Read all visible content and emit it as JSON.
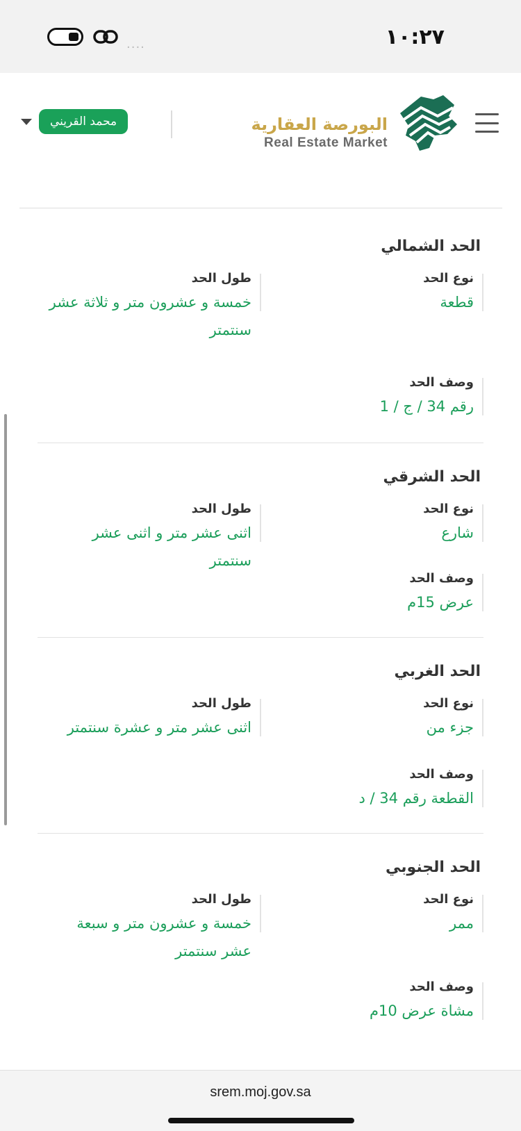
{
  "status_bar": {
    "time": "١٠:٢٧",
    "signal": "····"
  },
  "header": {
    "logo_ar": "البورصة العقارية",
    "logo_en": "Real Estate Market",
    "user_name": "محمد القريني"
  },
  "boundaries": [
    {
      "title": "الحد الشمالي",
      "type_label": "نوع الحد",
      "type_value": "قطعة",
      "length_label": "طول الحد",
      "length_value": "خمسة و عشرون متر و ثلاثة عشر سنتمتر",
      "desc_label": "وصف الحد",
      "desc_value": "رقم 34 / ج / 1"
    },
    {
      "title": "الحد الشرقي",
      "type_label": "نوع الحد",
      "type_value": "شارع",
      "length_label": "طول الحد",
      "length_value": "اثنى عشر متر و اثنى عشر سنتمتر",
      "desc_label": "وصف الحد",
      "desc_value": "عرض 15م"
    },
    {
      "title": "الحد الغربي",
      "type_label": "نوع الحد",
      "type_value": "جزء من",
      "length_label": "طول الحد",
      "length_value": "اثنى عشر متر و عشرة سنتمتر",
      "desc_label": "وصف الحد",
      "desc_value": "القطعة رقم 34 / د"
    },
    {
      "title": "الحد الجنوبي",
      "type_label": "نوع الحد",
      "type_value": "ممر",
      "length_label": "طول الحد",
      "length_value": "خمسة و عشرون متر و سبعة عشر سنتمتر",
      "desc_label": "وصف الحد",
      "desc_value": "مشاة عرض 10م"
    }
  ],
  "browser": {
    "url": "srem.moj.gov.sa"
  },
  "colors": {
    "accent": "#1aa159",
    "value_text": "#1b9e5a",
    "logo_gold": "#c9a64a"
  }
}
